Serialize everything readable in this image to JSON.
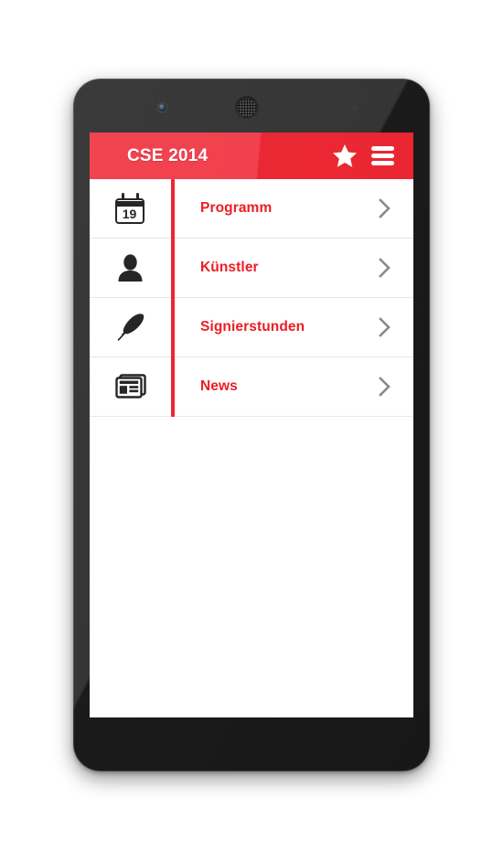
{
  "app": {
    "title": "CSE 2014",
    "accent_color": "#ed1c24",
    "header_color": "#ea2834",
    "label_color": "#ed1c24",
    "chevron_color": "#8a8a8a",
    "icon_color": "#262626",
    "background_color": "#ffffff"
  },
  "header": {
    "title": "CSE 2014",
    "actions": [
      {
        "name": "favorites",
        "icon": "star-icon"
      },
      {
        "name": "menu",
        "icon": "hamburger-menu-icon"
      }
    ]
  },
  "menu": {
    "items": [
      {
        "label": "Programm",
        "icon": "calendar-icon",
        "calendar_day": "19",
        "chevron": "›"
      },
      {
        "label": "Künstler",
        "icon": "person-icon",
        "chevron": "›"
      },
      {
        "label": "Signierstunden",
        "icon": "feather-icon",
        "chevron": "›"
      },
      {
        "label": "News",
        "icon": "newspaper-icon",
        "chevron": "›"
      }
    ]
  },
  "device": {
    "type": "smartphone-mockup",
    "hardware": [
      "front-camera",
      "earpiece-speaker",
      "proximity-sensor"
    ]
  }
}
